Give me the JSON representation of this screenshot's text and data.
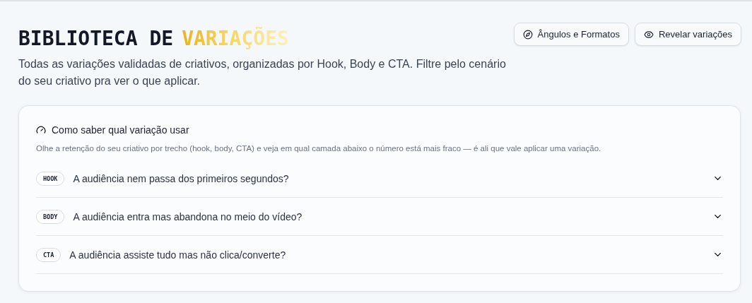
{
  "header": {
    "title": "BIBLIOTECA DE",
    "title_highlight": "VARIAÇÕES",
    "description": "Todas as variações validadas de criativos, organizadas por Hook, Body e CTA. Filtre pelo cenário do seu criativo pra ver o que aplicar."
  },
  "buttons": [
    {
      "label": "Ângulos e Formatos",
      "kind": "compass"
    },
    {
      "label": "Revelar variações",
      "kind": "eye"
    }
  ],
  "guide": {
    "title": "Como saber qual variação usar",
    "description": "Olhe a retenção do seu criativo por trecho (hook, body, CTA) e veja em qual camada abaixo o número está mais fraco — é ali que vale aplicar uma variação.",
    "items": [
      {
        "tag": "HOOK",
        "question": "A audiência nem passa dos primeiros segundos?",
        "expanded": false
      },
      {
        "tag": "BODY",
        "question": "A audiência entra mas abandona no meio do vídeo?",
        "expanded": false
      },
      {
        "tag": "CTA",
        "question": "A audiência assiste tudo mas não clica/converte?",
        "expanded": false
      }
    ]
  }
}
